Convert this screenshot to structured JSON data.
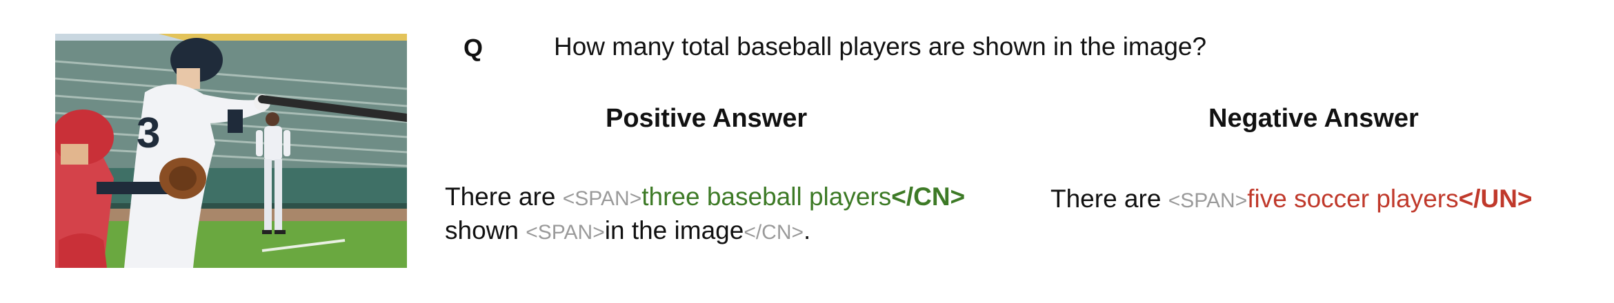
{
  "image": {
    "alt": "batter swinging at a pitch with a catcher crouched behind and an outfield player standing in the background",
    "jersey_number": "3"
  },
  "question": {
    "marker": "Q",
    "text": "How many total baseball players are shown in the image?"
  },
  "positive": {
    "heading": "Positive Answer",
    "prefix": "There are ",
    "span_open_1": "<SPAN>",
    "highlight": "three baseball players",
    "close_tag_1": "</CN>",
    "word_shown": "shown ",
    "span_open_2": "<SPAN>",
    "phrase_2": "in the image",
    "close_tag_2": "</CN>",
    "period": "."
  },
  "negative": {
    "heading": "Negative Answer",
    "prefix": "There are ",
    "span_open": "<SPAN>",
    "highlight": "five soccer players",
    "close_tag": "</UN>"
  },
  "colors": {
    "positive_highlight": "#3d7a26",
    "negative_highlight": "#c0392b",
    "tag_gray": "#9a9a9a"
  }
}
